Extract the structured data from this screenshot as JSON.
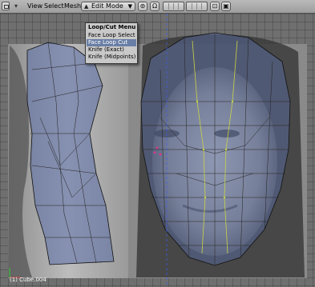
{
  "header": {
    "collapse_glyph": "▾",
    "menus": [
      {
        "label": "View"
      },
      {
        "label": "Select"
      },
      {
        "label": "Mesh"
      }
    ],
    "mode": {
      "label": "Edit Mode",
      "icon": "edit-mode-icon"
    },
    "accent": "#6a7fa6"
  },
  "menu": {
    "title": "Loop/Cut Menu",
    "items": [
      {
        "label": "Face Loop Select",
        "active": false
      },
      {
        "label": "Face Loop Cut",
        "active": true
      },
      {
        "label": "Knife (Exact)",
        "active": false
      },
      {
        "label": "Knife (Midpoints)",
        "active": false
      }
    ]
  },
  "status": {
    "object_label": "(1) Cube.004"
  }
}
